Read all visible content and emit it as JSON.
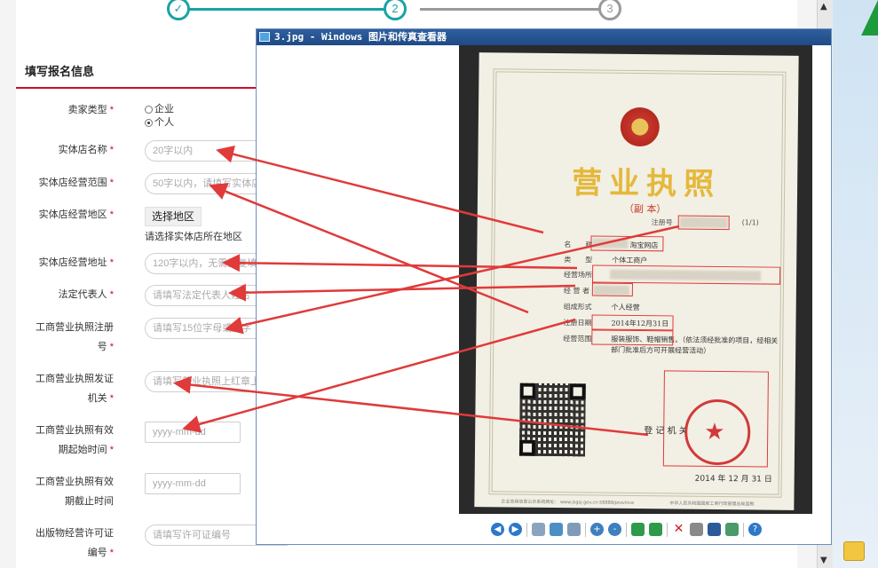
{
  "steps": {
    "step1_icon": "check-icon",
    "step2_label": "2",
    "step3_label": "3"
  },
  "form": {
    "section_title": "填写报名信息",
    "required_mark": "*",
    "seller_type": {
      "label": "卖家类型",
      "options": [
        "企业",
        "个人"
      ],
      "selected": "个人"
    },
    "store_name": {
      "label": "实体店名称",
      "placeholder": "20字以内"
    },
    "business_scope": {
      "label": "实体店经营范围",
      "placeholder": "50字以内，请填写实体店经营"
    },
    "store_region": {
      "label": "实体店经营地区",
      "button": "选择地区",
      "hint": "请选择实体店所在地区"
    },
    "store_address": {
      "label": "实体店经营地址",
      "placeholder": "120字以内，无需重复填写省"
    },
    "legal_rep": {
      "label": "法定代表人",
      "placeholder": "请填写法定代表人姓名"
    },
    "license_no": {
      "label_line1": "工商营业执照注册",
      "label_line2": "号",
      "placeholder": "请填写15位字母或数字"
    },
    "issuing_org": {
      "label_line1": "工商营业执照发证",
      "label_line2": "机关",
      "placeholder": "请填写营业执照上红章上的机"
    },
    "valid_start": {
      "label_line1": "工商营业执照有效",
      "label_line2": "期起始时间",
      "placeholder": "yyyy-mm-dd"
    },
    "valid_end": {
      "label_line1": "工商营业执照有效",
      "label_line2": "期截止时间",
      "placeholder": "yyyy-mm-dd"
    },
    "publication_permit": {
      "label_line1": "出版物经营许可证",
      "label_line2": "编号",
      "placeholder": "请填写许可证编号"
    }
  },
  "viewer": {
    "title": "3.jpg - Windows 图片和传真查看器",
    "toolbar_icons": [
      "prev-icon",
      "next-icon",
      "best-fit-icon",
      "actual-size-icon",
      "slideshow-icon",
      "zoom-in-icon",
      "zoom-out-icon",
      "rotate-cw-icon",
      "rotate-ccw-icon",
      "delete-icon",
      "print-icon",
      "save-icon",
      "edit-icon",
      "help-icon"
    ]
  },
  "license": {
    "title": "营业执照",
    "subtitle": "（副 本）",
    "reg_no_label": "注册号",
    "page_marker": "(1/1)",
    "fields": [
      {
        "label": "名　　称",
        "value": "淘宝网店"
      },
      {
        "label": "类　　型",
        "value": "个体工商户"
      },
      {
        "label": "经营场所",
        "value": ""
      },
      {
        "label": "经 营 者",
        "value": ""
      },
      {
        "label": "组成形式",
        "value": "个人经营"
      },
      {
        "label": "注册日期",
        "value": "2014年12月31日"
      },
      {
        "label": "经营范围",
        "value": "服装服饰、鞋帽销售。（依法须经批准的项目，经相关"
      },
      {
        "label": "",
        "value": "部门批准后方可开展经营活动）"
      }
    ],
    "registration_org": "登 记 机 关",
    "seal_date": "2014 年 12 月 31 日",
    "footer_left": "企业信用信息公示系统网址： www.jsgsj.gov.cn:58888/province",
    "footer_right": "中华人民共和国国家工商行政管理总局监制"
  },
  "colors": {
    "accent_teal": "#1aa3a3",
    "required_red": "#d0021b",
    "arrow_red": "#e03a3a",
    "rule_red": "#c8102e"
  }
}
